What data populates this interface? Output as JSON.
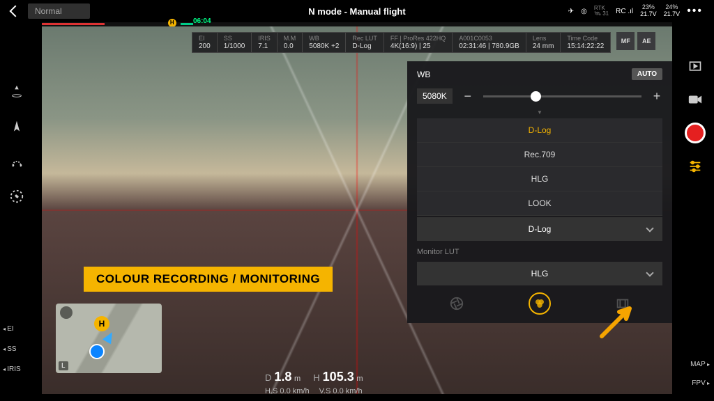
{
  "topbar": {
    "mode_pill": "Normal",
    "title": "N mode - Manual flight",
    "rtk_label": "RTK",
    "sats": "31",
    "rc": "RC",
    "batt1_pct": "23%",
    "batt1_v": "21.7V",
    "batt2_pct": "24%",
    "batt2_v": "21.7V"
  },
  "timeline": {
    "time": "06:04",
    "marker": "H"
  },
  "info": [
    {
      "label": "EI",
      "val": "200"
    },
    {
      "label": "SS",
      "val": "1/1000"
    },
    {
      "label": "IRIS",
      "val": "7.1"
    },
    {
      "label": "M.M",
      "val": "0.0"
    },
    {
      "label": "WB",
      "val": "5080K +2"
    },
    {
      "label": "Rec LUT",
      "val": "D-Log"
    },
    {
      "label": "FF | ProRes 422HQ",
      "val": "4K(16:9) | 25"
    },
    {
      "label": "A001C0053",
      "val": "02:31:46 | 780.9GB"
    },
    {
      "label": "Lens",
      "val": "24 mm"
    },
    {
      "label": "Time Code",
      "val": "15:14:22:22"
    }
  ],
  "mf": "MF",
  "ae": "AE",
  "wb_panel": {
    "title": "WB",
    "auto": "AUTO",
    "value": "5080K",
    "options": [
      "D-Log",
      "Rec.709",
      "HLG",
      "LOOK"
    ],
    "selected": "D-Log",
    "monitor_label": "Monitor LUT",
    "monitor_value": "HLG"
  },
  "banner": "COLOUR RECORDING / MONITORING",
  "params": [
    "EI",
    "SS",
    "IRIS"
  ],
  "telemetry": {
    "d_lbl": "D",
    "d_val": "1.8",
    "d_unit": "m",
    "h_lbl": "H",
    "h_val": "105.3",
    "h_unit": "m",
    "hs_lbl": "H.S",
    "hs_val": "0.0 km/h",
    "vs_lbl": "V.S",
    "vs_val": "0.0 km/h"
  },
  "right_labels": [
    "MAP",
    "FPV"
  ],
  "minimap": {
    "h": "H",
    "l": "L"
  }
}
